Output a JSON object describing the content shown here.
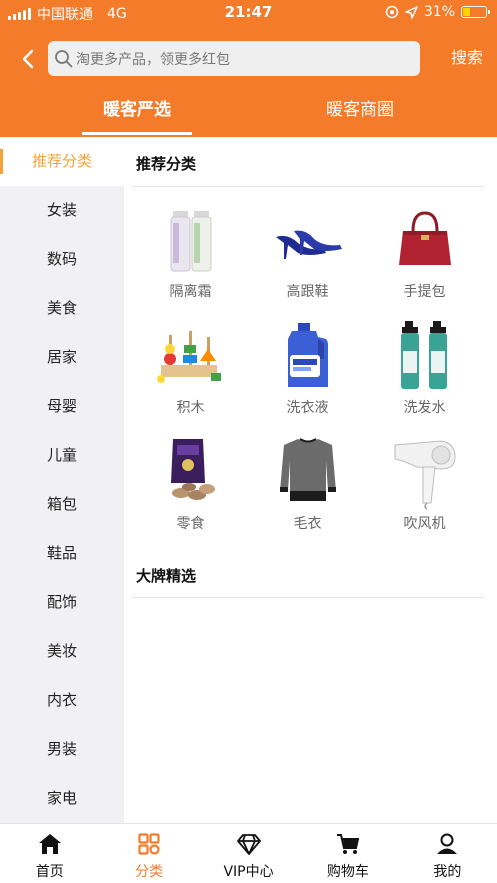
{
  "status_bar": {
    "carrier": "中国联通",
    "network": "4G",
    "time": "21:47",
    "battery": "31%",
    "battery_level": 0.31
  },
  "search": {
    "placeholder": "淘更多产品，领更多红包",
    "button_label": "搜索"
  },
  "tabs": [
    {
      "label": "暖客严选",
      "active": true
    },
    {
      "label": "暖客商圈",
      "active": false
    }
  ],
  "sidebar": {
    "items": [
      {
        "label": "推荐分类",
        "active": true
      },
      {
        "label": "女装"
      },
      {
        "label": "数码"
      },
      {
        "label": "美食"
      },
      {
        "label": "居家"
      },
      {
        "label": "母婴"
      },
      {
        "label": "儿童"
      },
      {
        "label": "箱包"
      },
      {
        "label": "鞋品"
      },
      {
        "label": "配饰"
      },
      {
        "label": "美妆"
      },
      {
        "label": "内衣"
      },
      {
        "label": "男装"
      },
      {
        "label": "家电"
      }
    ]
  },
  "main": {
    "section_title": "推荐分类",
    "categories": [
      {
        "label": "隔离霜",
        "icon": "primer-bottles-icon"
      },
      {
        "label": "高跟鞋",
        "icon": "high-heels-icon"
      },
      {
        "label": "手提包",
        "icon": "handbag-icon"
      },
      {
        "label": "积木",
        "icon": "building-blocks-icon"
      },
      {
        "label": "洗衣液",
        "icon": "detergent-bottle-icon"
      },
      {
        "label": "洗发水",
        "icon": "shampoo-bottles-icon"
      },
      {
        "label": "零食",
        "icon": "snack-bag-icon"
      },
      {
        "label": "毛衣",
        "icon": "sweater-icon"
      },
      {
        "label": "吹风机",
        "icon": "hair-dryer-icon"
      }
    ],
    "brand_title": "大牌精选"
  },
  "bottom_nav": [
    {
      "label": "首页",
      "icon": "home-icon"
    },
    {
      "label": "分类",
      "icon": "category-icon",
      "active": true
    },
    {
      "label": "VIP中心",
      "icon": "diamond-icon"
    },
    {
      "label": "购物车",
      "icon": "cart-icon"
    },
    {
      "label": "我的",
      "icon": "user-icon"
    }
  ],
  "colors": {
    "brand_orange": "#f47b2a",
    "active_accent": "#f2a43a",
    "sidebar_bg": "#f1f1f3"
  }
}
